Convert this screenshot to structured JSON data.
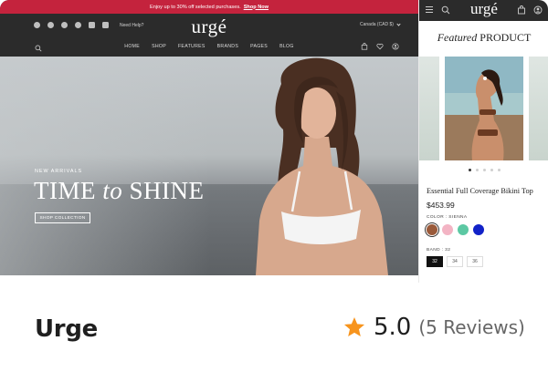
{
  "promo": {
    "text": "Enjoy up to 30% off selected purchases.",
    "link": "Shop Now"
  },
  "header": {
    "help": "Need Help?",
    "logo": "urgé",
    "currency": "Canada (CAD $)",
    "nav": [
      "HOME",
      "SHOP",
      "FEATURES",
      "BRANDS",
      "PAGES",
      "BLOG"
    ],
    "icons": [
      "search-icon",
      "bag-icon",
      "heart-icon",
      "user-icon"
    ],
    "socials": [
      "facebook-icon",
      "twitter-icon",
      "pinterest-icon",
      "instagram-icon",
      "linkedin-icon",
      "youtube-icon"
    ]
  },
  "hero": {
    "kicker": "NEW ARRIVALS",
    "headline_a": "TIME ",
    "headline_b": "to",
    "headline_c": " SHINE",
    "button": "SHOP COLLECTION"
  },
  "mobile": {
    "logo": "urgé",
    "featured_a": "Featured",
    "featured_b": " PRODUCT",
    "product_title": "Essential Full Coverage Bikini Top",
    "price": "$453.99",
    "color_label": "COLOR : SIENNA",
    "colors": [
      "#9a5a3a",
      "#f3b4c4",
      "#5cc8a3",
      "#1222c8"
    ],
    "band_label": "BAND : 32",
    "sizes": [
      "32",
      "34",
      "36"
    ],
    "selected_size_index": 0,
    "gallery_dots": 5,
    "active_dot": 0
  },
  "footer": {
    "title": "Urge",
    "rating": "5.0",
    "reviews": "(5 Reviews)",
    "star_color": "#f7941d"
  },
  "colors": {
    "promo": "#c4233d",
    "header": "#2b2b2b"
  }
}
